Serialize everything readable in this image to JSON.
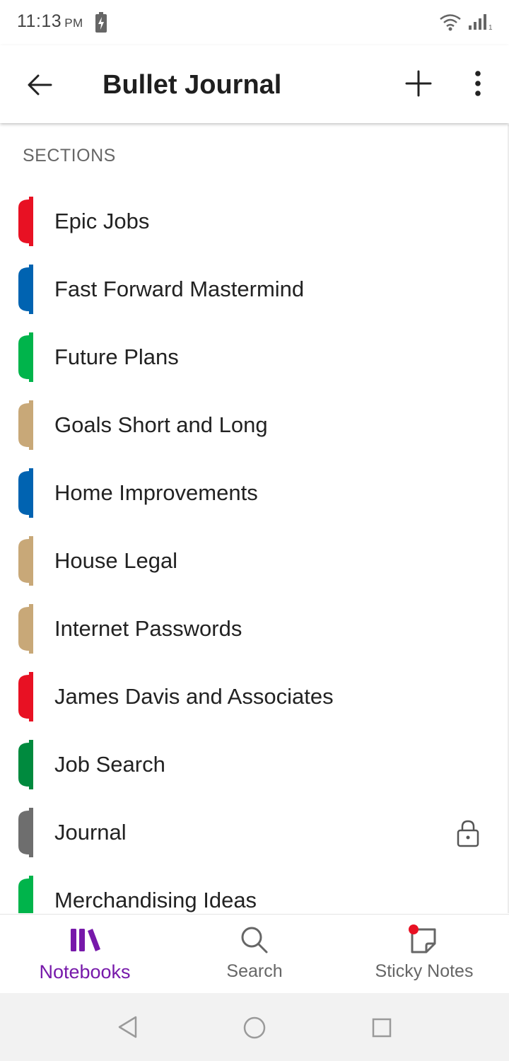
{
  "status_bar": {
    "time": "11:13",
    "ampm": "PM"
  },
  "app_bar": {
    "title": "Bullet Journal"
  },
  "sections_header": "SECTIONS",
  "sections": [
    {
      "label": "Epic Jobs",
      "color": "#e81123",
      "locked": false
    },
    {
      "label": "Fast Forward Mastermind",
      "color": "#0063b1",
      "locked": false
    },
    {
      "label": "Future Plans",
      "color": "#00b44b",
      "locked": false
    },
    {
      "label": "Goals Short and Long",
      "color": "#c8a878",
      "locked": false
    },
    {
      "label": "Home Improvements",
      "color": "#0063b1",
      "locked": false
    },
    {
      "label": "House Legal",
      "color": "#c8a878",
      "locked": false
    },
    {
      "label": "Internet Passwords",
      "color": "#c8a878",
      "locked": false
    },
    {
      "label": "James Davis and Associates",
      "color": "#e81123",
      "locked": false
    },
    {
      "label": "Job Search",
      "color": "#008a3e",
      "locked": false
    },
    {
      "label": "Journal",
      "color": "#6e6e6e",
      "locked": true
    },
    {
      "label": "Merchandising Ideas",
      "color": "#00b44b",
      "locked": false
    }
  ],
  "bottom_nav": {
    "notebooks": "Notebooks",
    "search": "Search",
    "sticky_notes": "Sticky Notes"
  },
  "colors": {
    "accent": "#7719aa",
    "notification_dot": "#e81123"
  }
}
